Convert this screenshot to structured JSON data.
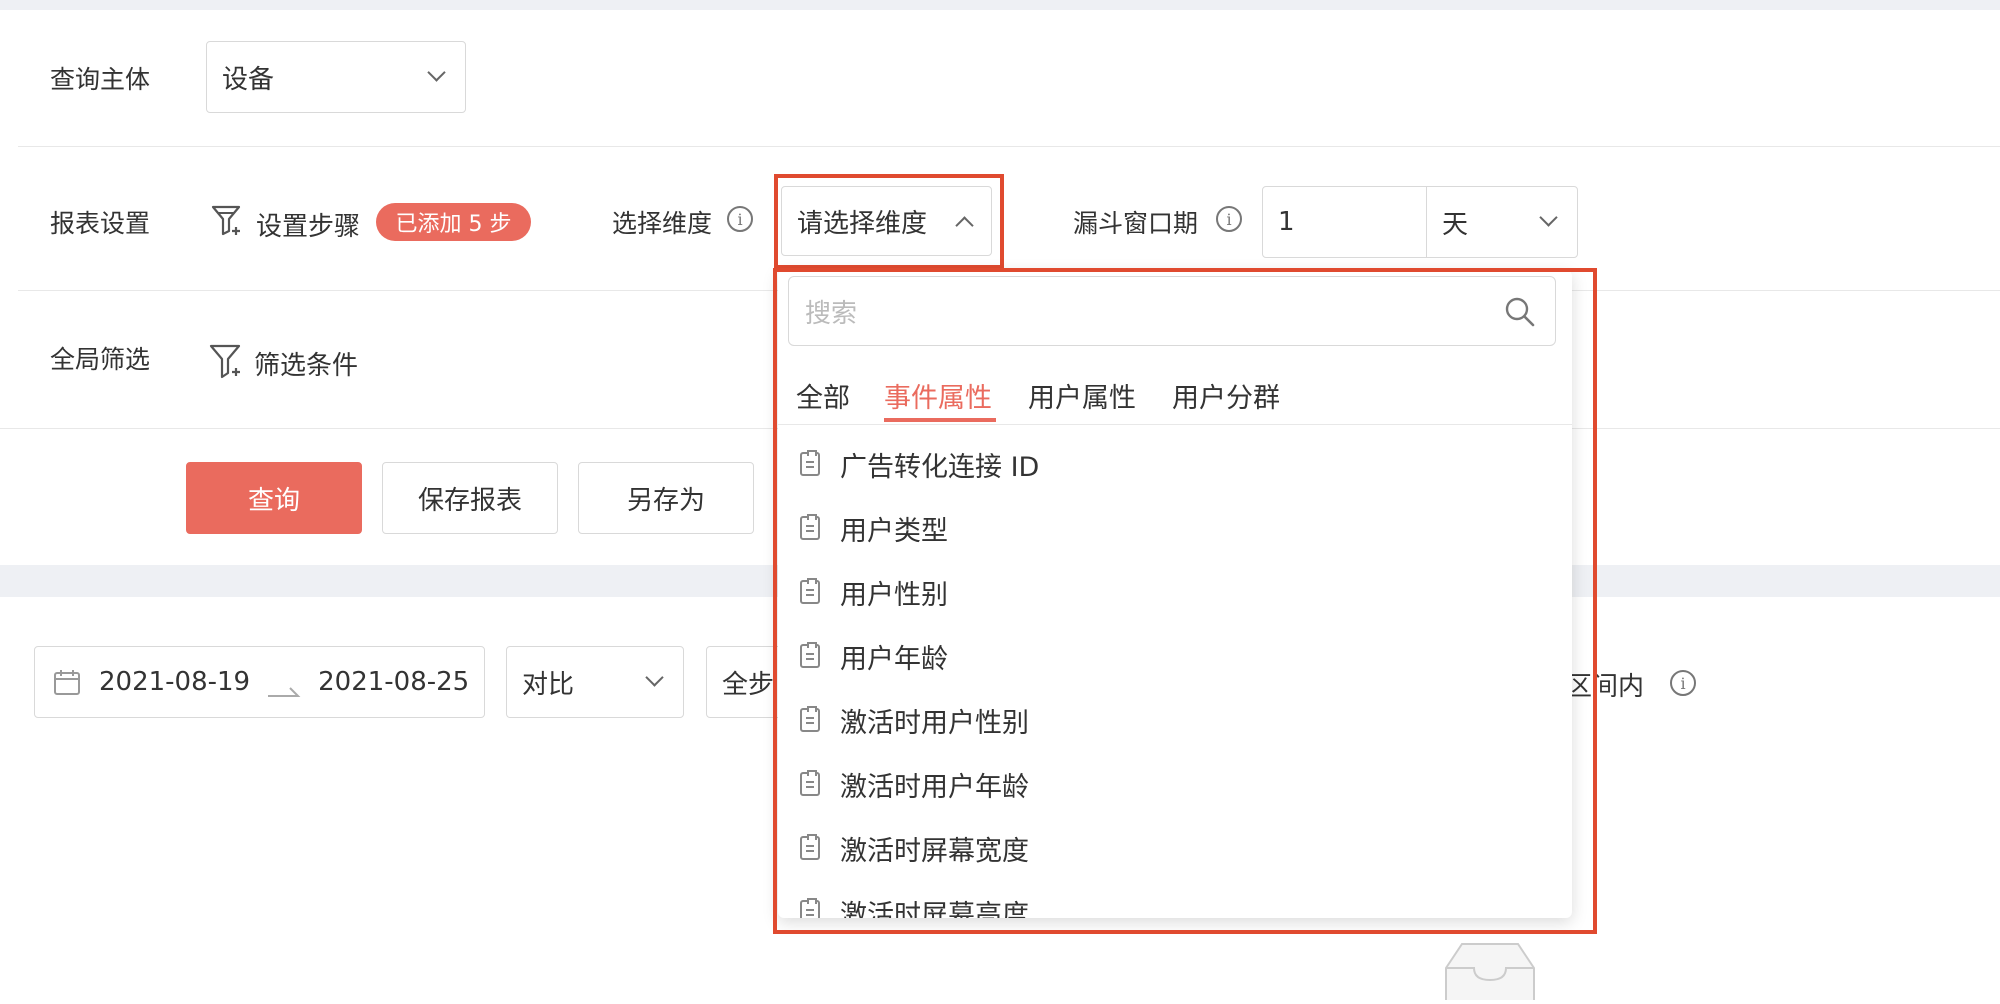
{
  "query_subject": {
    "label": "查询主体",
    "value": "设备"
  },
  "report_settings": {
    "label": "报表设置",
    "steps_label": "设置步骤",
    "steps_badge": "已添加 5 步",
    "dimension_label": "选择维度",
    "dimension_placeholder": "请选择维度",
    "window_label": "漏斗窗口期",
    "window_value": "1",
    "window_unit": "天"
  },
  "global_filter": {
    "label": "全局筛选",
    "filter_label": "筛选条件"
  },
  "actions": {
    "query": "查询",
    "save_report": "保存报表",
    "save_as": "另存为"
  },
  "results_bar": {
    "date_start": "2021-08-19",
    "date_end": "2021-08-25",
    "compare": "对比",
    "steps_select": "全步",
    "interval_text": "区间内"
  },
  "dropdown": {
    "search_placeholder": "搜索",
    "tabs": [
      "全部",
      "事件属性",
      "用户属性",
      "用户分群"
    ],
    "active_tab": 1,
    "items": [
      "广告转化连接 ID",
      "用户类型",
      "用户性别",
      "用户年龄",
      "激活时用户性别",
      "激活时用户年龄",
      "激活时屏幕宽度",
      "激活时屏幕高度"
    ]
  },
  "colors": {
    "accent": "#ea6b5e",
    "highlight": "#e04a2f"
  },
  "icons": [
    "chevron-down-icon",
    "chevron-up-icon",
    "steps-filter-icon",
    "filter-icon",
    "info-icon",
    "calendar-icon",
    "search-icon",
    "list-item-icon",
    "empty-box-icon"
  ]
}
